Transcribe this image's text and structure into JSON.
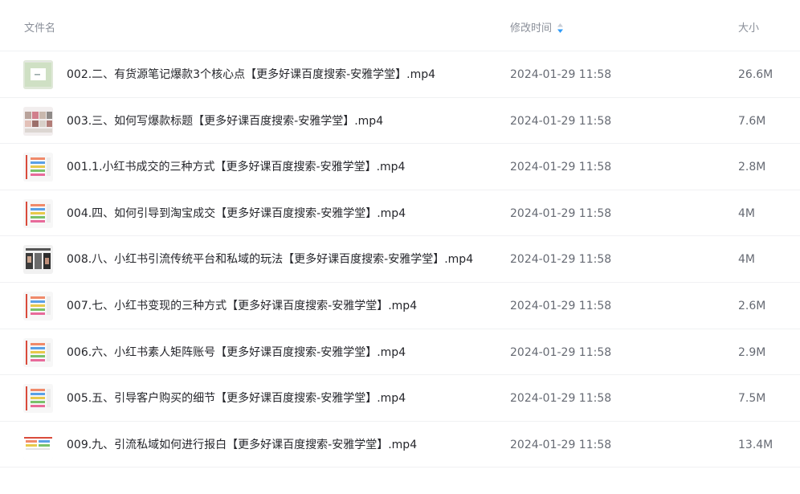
{
  "header": {
    "name_label": "文件名",
    "time_label": "修改时间",
    "size_label": "大小",
    "sort_icon": "sort-desc-icon",
    "sort_color": "#2e9af7"
  },
  "files": [
    {
      "name": "002.二、有货源笔记爆款3个核心点【更多好课百度搜索-安雅学堂】.mp4",
      "time": "2024-01-29 11:58",
      "size": "26.6M",
      "thumb": "video-thumb-green"
    },
    {
      "name": "003.三、如何写爆款标题【更多好课百度搜索-安雅学堂】.mp4",
      "time": "2024-01-29 11:58",
      "size": "7.6M",
      "thumb": "video-thumb-collage"
    },
    {
      "name": "001.1.小红书成交的三种方式【更多好课百度搜索-安雅学堂】.mp4",
      "time": "2024-01-29 11:58",
      "size": "2.8M",
      "thumb": "video-thumb-slides"
    },
    {
      "name": "004.四、如何引导到淘宝成交【更多好课百度搜索-安雅学堂】.mp4",
      "time": "2024-01-29 11:58",
      "size": "4M",
      "thumb": "video-thumb-slides"
    },
    {
      "name": "008.八、小红书引流传统平台和私域的玩法【更多好课百度搜索-安雅学堂】.mp4",
      "time": "2024-01-29 11:58",
      "size": "4M",
      "thumb": "video-thumb-dark"
    },
    {
      "name": "007.七、小红书变现的三种方式【更多好课百度搜索-安雅学堂】.mp4",
      "time": "2024-01-29 11:58",
      "size": "2.6M",
      "thumb": "video-thumb-slides"
    },
    {
      "name": "006.六、小红书素人矩阵账号【更多好课百度搜索-安雅学堂】.mp4",
      "time": "2024-01-29 11:58",
      "size": "2.9M",
      "thumb": "video-thumb-slides"
    },
    {
      "name": "005.五、引导客户购买的细节【更多好课百度搜索-安雅学堂】.mp4",
      "time": "2024-01-29 11:58",
      "size": "7.5M",
      "thumb": "video-thumb-slides"
    },
    {
      "name": "009.九、引流私域如何进行报白【更多好课百度搜索-安雅学堂】.mp4",
      "time": "2024-01-29 11:58",
      "size": "13.4M",
      "thumb": "video-thumb-wide"
    }
  ]
}
